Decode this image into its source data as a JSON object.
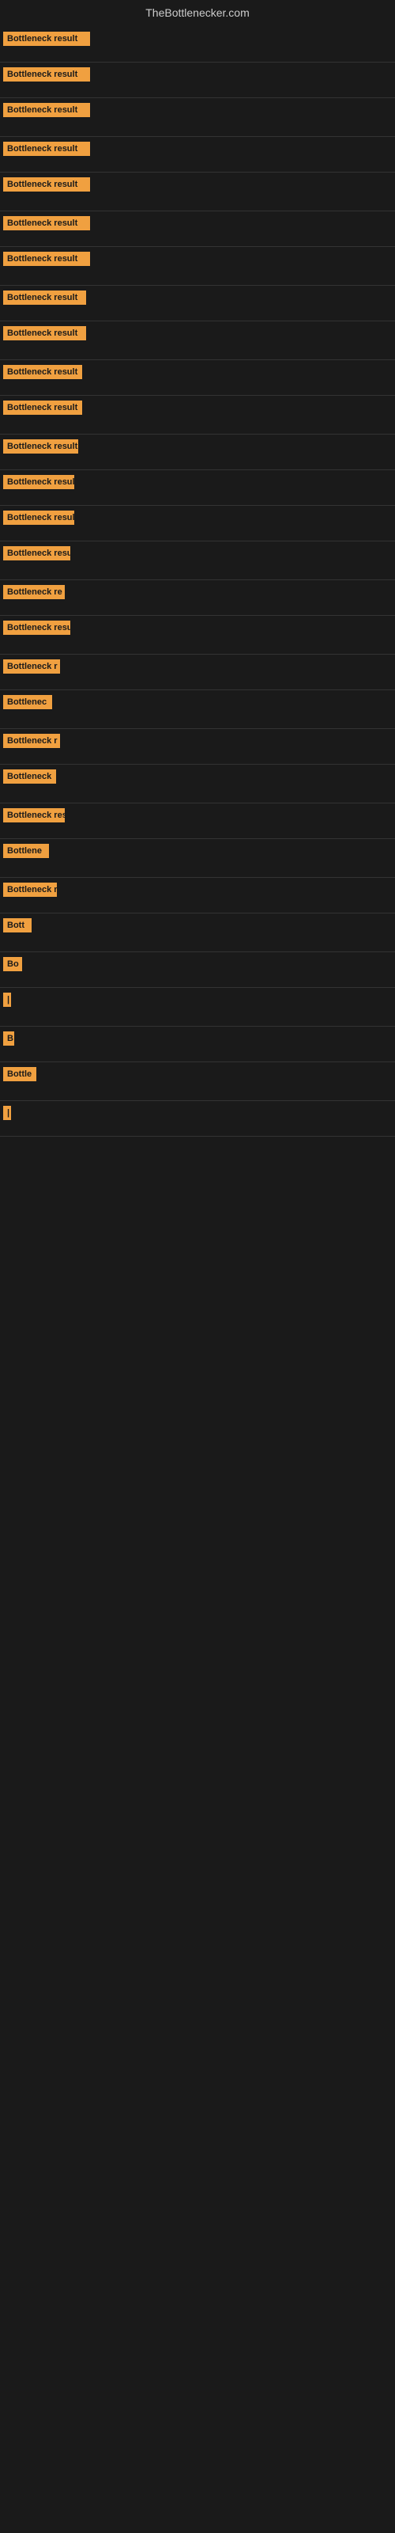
{
  "site_title": "TheBottlenecker.com",
  "bars": [
    {
      "label": "Bottleneck result",
      "width": 110,
      "gap_after": 18
    },
    {
      "label": "Bottleneck result",
      "width": 110,
      "gap_after": 18
    },
    {
      "label": "Bottleneck result",
      "width": 110,
      "gap_after": 22
    },
    {
      "label": "Bottleneck result",
      "width": 110,
      "gap_after": 18
    },
    {
      "label": "Bottleneck result",
      "width": 110,
      "gap_after": 22
    },
    {
      "label": "Bottleneck result",
      "width": 110,
      "gap_after": 18
    },
    {
      "label": "Bottleneck result",
      "width": 110,
      "gap_after": 22
    },
    {
      "label": "Bottleneck result",
      "width": 105,
      "gap_after": 18
    },
    {
      "label": "Bottleneck result",
      "width": 105,
      "gap_after": 22
    },
    {
      "label": "Bottleneck result",
      "width": 100,
      "gap_after": 18
    },
    {
      "label": "Bottleneck result",
      "width": 100,
      "gap_after": 22
    },
    {
      "label": "Bottleneck result",
      "width": 95,
      "gap_after": 18
    },
    {
      "label": "Bottleneck result",
      "width": 90,
      "gap_after": 18
    },
    {
      "label": "Bottleneck result",
      "width": 90,
      "gap_after": 18
    },
    {
      "label": "Bottleneck result",
      "width": 85,
      "gap_after": 22
    },
    {
      "label": "Bottleneck re",
      "width": 78,
      "gap_after": 18
    },
    {
      "label": "Bottleneck result",
      "width": 85,
      "gap_after": 22
    },
    {
      "label": "Bottleneck r",
      "width": 72,
      "gap_after": 18
    },
    {
      "label": "Bottlenec",
      "width": 62,
      "gap_after": 22
    },
    {
      "label": "Bottleneck r",
      "width": 72,
      "gap_after": 18
    },
    {
      "label": "Bottleneck",
      "width": 67,
      "gap_after": 22
    },
    {
      "label": "Bottleneck res",
      "width": 78,
      "gap_after": 18
    },
    {
      "label": "Bottlene",
      "width": 58,
      "gap_after": 22
    },
    {
      "label": "Bottleneck r",
      "width": 68,
      "gap_after": 18
    },
    {
      "label": "Bott",
      "width": 36,
      "gap_after": 22
    },
    {
      "label": "Bo",
      "width": 24,
      "gap_after": 18
    },
    {
      "label": "|",
      "width": 8,
      "gap_after": 22
    },
    {
      "label": "B",
      "width": 14,
      "gap_after": 18
    },
    {
      "label": "Bottle",
      "width": 42,
      "gap_after": 22
    },
    {
      "label": "|",
      "width": 6,
      "gap_after": 18
    }
  ]
}
